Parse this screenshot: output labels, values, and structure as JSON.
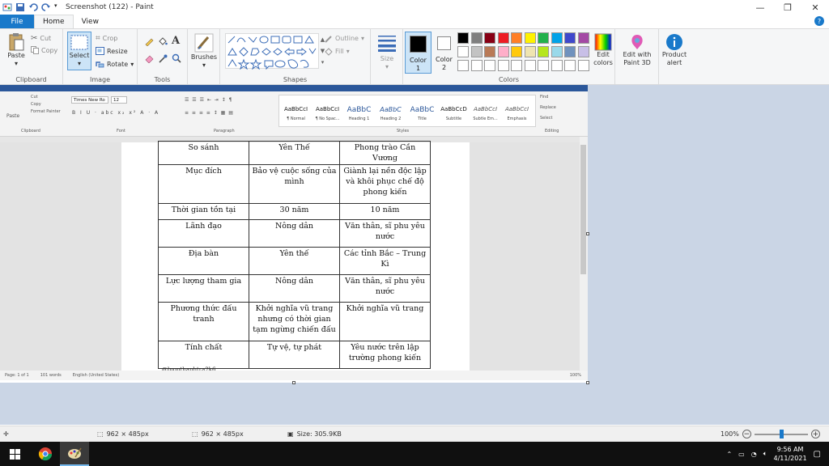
{
  "window": {
    "title": "Screenshot (122) - Paint",
    "minimize": "—",
    "maximize": "❐",
    "close": "✕"
  },
  "tabs": [
    {
      "label": "File"
    },
    {
      "label": "Home"
    },
    {
      "label": "View"
    }
  ],
  "ribbon": {
    "clipboard": {
      "label": "Clipboard",
      "paste": "Paste",
      "cut": "Cut",
      "copy": "Copy"
    },
    "image": {
      "label": "Image",
      "select": "Select",
      "crop": "Crop",
      "resize": "Resize",
      "rotate": "Rotate"
    },
    "tools": {
      "label": "Tools"
    },
    "brushes": {
      "label": "Brushes"
    },
    "shapes": {
      "label": "Shapes",
      "outline": "Outline",
      "fill": "Fill"
    },
    "size": {
      "label": "Size"
    },
    "color1": {
      "label": "Color",
      "num": "1"
    },
    "color2": {
      "label": "Color",
      "num": "2"
    },
    "colors": {
      "label": "Colors"
    },
    "edit_colors": {
      "line1": "Edit",
      "line2": "colors"
    },
    "paint3d": {
      "line1": "Edit with",
      "line2": "Paint 3D"
    },
    "product_alert": {
      "line1": "Product",
      "line2": "alert"
    }
  },
  "palette": {
    "row1": [
      "#000000",
      "#7f7f7f",
      "#880015",
      "#ed1c24",
      "#ff7f27",
      "#fff200",
      "#22b14c",
      "#00a2e8",
      "#3f48cc",
      "#a349a4"
    ],
    "row2": [
      "#ffffff",
      "#c3c3c3",
      "#b97a57",
      "#ffaec9",
      "#ffc90e",
      "#efe4b0",
      "#b5e61d",
      "#99d9ea",
      "#7092be",
      "#c8bfe7"
    ],
    "row3": [
      "#ffffff",
      "#ffffff",
      "#ffffff",
      "#ffffff",
      "#ffffff",
      "#ffffff",
      "#ffffff",
      "#ffffff",
      "#ffffff",
      "#ffffff"
    ]
  },
  "word": {
    "font_name": "Times New Ro",
    "font_size": "12",
    "clipboard_label": "Clipboard",
    "font_label": "Font",
    "paragraph_label": "Paragraph",
    "styles_label": "Styles",
    "editing_label": "Editing",
    "paste": "Paste",
    "cut": "Cut",
    "copy": "Copy",
    "format_painter": "Format Painter",
    "find": "Find",
    "replace": "Replace",
    "select": "Select",
    "styles": [
      {
        "sample": "AaBbCcI",
        "name": "¶ Normal"
      },
      {
        "sample": "AaBbCcI",
        "name": "¶ No Spac..."
      },
      {
        "sample": "AaBbC",
        "name": "Heading 1"
      },
      {
        "sample": "AaBbC",
        "name": "Heading 2"
      },
      {
        "sample": "AaBbC",
        "name": "Title"
      },
      {
        "sample": "AaBbCcD",
        "name": "Subtitle"
      },
      {
        "sample": "AaBbCcI",
        "name": "Subtle Em..."
      },
      {
        "sample": "AaBbCcI",
        "name": "Emphasis"
      }
    ],
    "status": {
      "page": "Page: 1 of 1",
      "words": "101 words",
      "lang": "English (United States)",
      "zoom": "100%"
    },
    "watermark": "@luonthanhtra2k6"
  },
  "table": [
    [
      "So sánh",
      "Yên Thế",
      "Phong trào Cần Vương"
    ],
    [
      "Mục đích",
      "Bảo vệ cuộc sống của mình",
      "Giành lại nền độc lập và khôi phục chế độ phong kiến"
    ],
    [
      "Thời gian tồn tại",
      "30 năm",
      "10 năm"
    ],
    [
      "Lãnh đạo",
      "Nông dân",
      "Văn thân, sĩ phu yêu nước"
    ],
    [
      "Địa bàn",
      "Yên thế",
      "Các tỉnh Bắc – Trung Kì"
    ],
    [
      "Lực lượng tham gia",
      "Nông dân",
      "Văn thân, sĩ phu yêu nước"
    ],
    [
      "Phương thức đấu tranh",
      "Khởi nghĩa vũ trang nhưng có thời gian tạm ngừng chiến đấu",
      "Khởi nghĩa vũ trang"
    ],
    [
      "Tính chất",
      "Tự vệ, tự phát",
      "Yêu nước trên lập trường phong kiến"
    ]
  ],
  "statusbar": {
    "selection_size": "962 × 485px",
    "image_size": "962 × 485px",
    "file_size": "Size: 305.9KB",
    "zoom": "100%"
  },
  "taskbar": {
    "time": "9:56 AM",
    "date": "4/11/2021"
  },
  "colors": {
    "accent": "#1979ca",
    "canvas_bg": "#cad5e5",
    "word_blue": "#2b579a"
  }
}
